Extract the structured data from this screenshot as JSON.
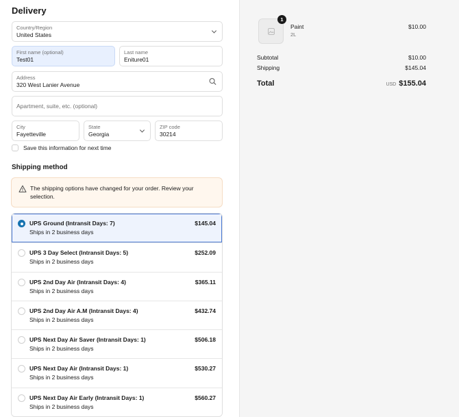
{
  "delivery": {
    "heading": "Delivery",
    "country": {
      "label": "Country/Region",
      "value": "United States"
    },
    "first_name": {
      "label": "First name (optional)",
      "value": "Test01"
    },
    "last_name": {
      "label": "Last name",
      "value": "Eniture01"
    },
    "address": {
      "label": "Address",
      "value": "320 West Lanier Avenue"
    },
    "apartment": {
      "placeholder": "Apartment, suite, etc. (optional)"
    },
    "city": {
      "label": "City",
      "value": "Fayetteville"
    },
    "state": {
      "label": "State",
      "value": "Georgia"
    },
    "zip": {
      "label": "ZIP code",
      "value": "30214"
    },
    "save_info": {
      "label": "Save this information for next time",
      "checked": false
    }
  },
  "shipping": {
    "heading": "Shipping method",
    "notice": "The shipping options have changed for your order. Review your selection.",
    "options": [
      {
        "name": "UPS Ground (Intransit Days: 7)",
        "sub": "Ships in 2 business days",
        "price": "$145.04",
        "selected": true
      },
      {
        "name": "UPS 3 Day Select (Intransit Days: 5)",
        "sub": "Ships in 2 business days",
        "price": "$252.09",
        "selected": false
      },
      {
        "name": "UPS 2nd Day Air (Intransit Days: 4)",
        "sub": "Ships in 2 business days",
        "price": "$365.11",
        "selected": false
      },
      {
        "name": "UPS 2nd Day Air A.M (Intransit Days: 4)",
        "sub": "Ships in 2 business days",
        "price": "$432.74",
        "selected": false
      },
      {
        "name": "UPS Next Day Air Saver (Intransit Days: 1)",
        "sub": "Ships in 2 business days",
        "price": "$506.18",
        "selected": false
      },
      {
        "name": "UPS Next Day Air (Intransit Days: 1)",
        "sub": "Ships in 2 business days",
        "price": "$530.27",
        "selected": false
      },
      {
        "name": "UPS Next Day Air Early (Intransit Days: 1)",
        "sub": "Ships in 2 business days",
        "price": "$560.27",
        "selected": false
      }
    ]
  },
  "summary": {
    "item": {
      "quantity": "1",
      "name": "Paint",
      "variant": "2L",
      "price": "$10.00"
    },
    "subtotal": {
      "label": "Subtotal",
      "value": "$10.00"
    },
    "shipping": {
      "label": "Shipping",
      "value": "$145.04"
    },
    "total": {
      "label": "Total",
      "currency": "USD",
      "value": "$155.04"
    }
  },
  "colors": {
    "accent": "#1773b0",
    "notice_bg": "#fff7ee",
    "sidebar_bg": "#f5f5f5"
  }
}
